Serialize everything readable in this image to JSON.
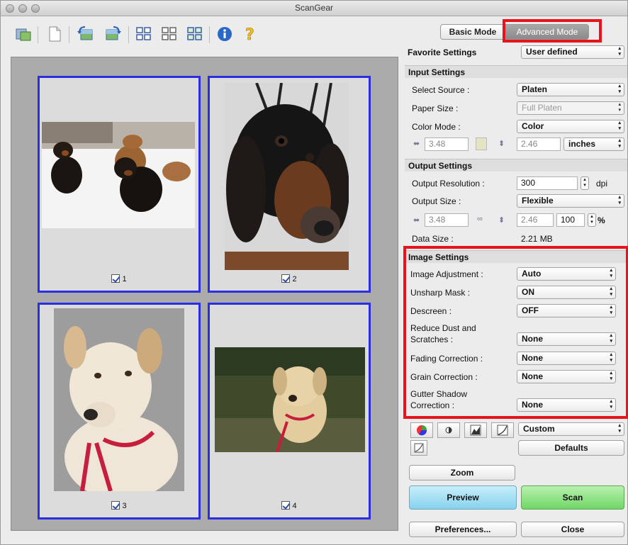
{
  "window": {
    "title": "ScanGear"
  },
  "toolbar": {
    "items": [
      "rotate-icon",
      "clear-icon",
      "rotate-left-icon",
      "rotate-right-icon",
      "thumbnail-view-icon",
      "whole-image-view-icon",
      "multi-crop-icon",
      "info-icon",
      "help-icon"
    ]
  },
  "preview": {
    "frames": [
      {
        "label": "1",
        "checked": true
      },
      {
        "label": "2",
        "checked": true
      },
      {
        "label": "3",
        "checked": true
      },
      {
        "label": "4",
        "checked": true
      }
    ]
  },
  "mode": {
    "basic": "Basic Mode",
    "advanced": "Advanced Mode"
  },
  "favorite": {
    "label": "Favorite Settings",
    "value": "User defined"
  },
  "input": {
    "title": "Input Settings",
    "source_label": "Select Source :",
    "source_value": "Platen",
    "paper_label": "Paper Size :",
    "paper_value": "Full Platen",
    "color_label": "Color Mode :",
    "color_value": "Color",
    "width": "3.48",
    "height": "2.46",
    "unit": "inches"
  },
  "output": {
    "title": "Output Settings",
    "res_label": "Output Resolution :",
    "res_value": "300",
    "res_unit": "dpi",
    "size_label": "Output Size :",
    "size_value": "Flexible",
    "width": "3.48",
    "height": "2.46",
    "scale": "100",
    "scale_unit": "%",
    "data_label": "Data Size :",
    "data_value": "2.21 MB"
  },
  "image": {
    "title": "Image Settings",
    "adj_label": "Image Adjustment :",
    "adj_value": "Auto",
    "unsharp_label": "Unsharp Mask :",
    "unsharp_value": "ON",
    "descreen_label": "Descreen :",
    "descreen_value": "OFF",
    "dust_label_1": "Reduce Dust and",
    "dust_label_2": "Scratches :",
    "dust_value": "None",
    "fading_label": "Fading Correction :",
    "fading_value": "None",
    "grain_label": "Grain Correction :",
    "grain_value": "None",
    "gutter_label_1": "Gutter Shadow",
    "gutter_label_2": "Correction :",
    "gutter_value": "None"
  },
  "tone": {
    "custom": "Custom",
    "defaults": "Defaults"
  },
  "buttons": {
    "zoom": "Zoom",
    "preview": "Preview",
    "scan": "Scan",
    "preferences": "Preferences...",
    "close": "Close"
  },
  "colors": {
    "highlight": "#e8141b",
    "frame": "#2a2ee0",
    "preview_btn": "#8fd6ef",
    "scan_btn": "#7fd975"
  }
}
